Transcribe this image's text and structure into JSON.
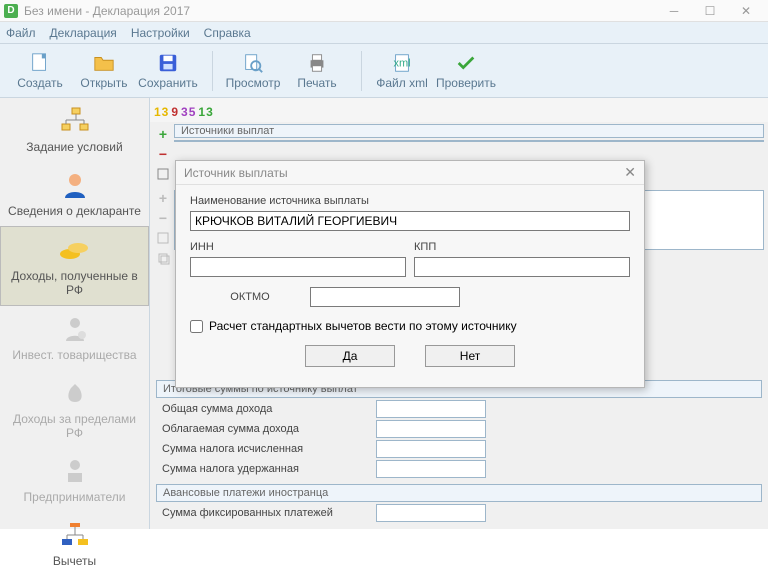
{
  "window": {
    "app_icon_letter": "D",
    "title": "Без имени - Декларация 2017"
  },
  "menu": {
    "items": [
      "Файл",
      "Декларация",
      "Настройки",
      "Справка"
    ]
  },
  "toolbar": {
    "create": "Создать",
    "open": "Открыть",
    "save": "Сохранить",
    "preview": "Просмотр",
    "print": "Печать",
    "file_xml": "Файл xml",
    "check": "Проверить"
  },
  "digits": [
    "13",
    "9",
    "35",
    "13"
  ],
  "digit_colors": [
    "#e6b800",
    "#c03030",
    "#a040c0",
    "#3aa63a"
  ],
  "sidebar": {
    "items": [
      {
        "label": "Задание условий",
        "disabled": false
      },
      {
        "label": "Сведения о декларанте",
        "disabled": false
      },
      {
        "label": "Доходы, полученные в РФ",
        "disabled": false,
        "selected": true
      },
      {
        "label": "Инвест. товарищества",
        "disabled": true
      },
      {
        "label": "Доходы за пределами РФ",
        "disabled": true
      },
      {
        "label": "Предприниматели",
        "disabled": true
      },
      {
        "label": "Вычеты",
        "disabled": false
      }
    ]
  },
  "main": {
    "sources_header": "Источники выплат",
    "totals_header": "Итоговые суммы по источнику выплат",
    "totals": [
      "Общая сумма дохода",
      "Облагаемая сумма дохода",
      "Сумма налога исчисленная",
      "Сумма налога удержанная"
    ],
    "advance_header": "Авансовые платежи иностранца",
    "advance_row": "Сумма фиксированных платежей"
  },
  "dialog": {
    "title": "Источник выплаты",
    "label_name": "Наименование источника выплаты",
    "value_name": "КРЮЧКОВ ВИТАЛИЙ ГЕОРГИЕВИЧ",
    "label_inn": "ИНН",
    "value_inn": "",
    "label_kpp": "КПП",
    "value_kpp": "",
    "label_oktmo": "ОКТМО",
    "value_oktmo": "",
    "checkbox_label": "Расчет стандартных вычетов вести по этому источнику",
    "btn_yes": "Да",
    "btn_no": "Нет"
  }
}
